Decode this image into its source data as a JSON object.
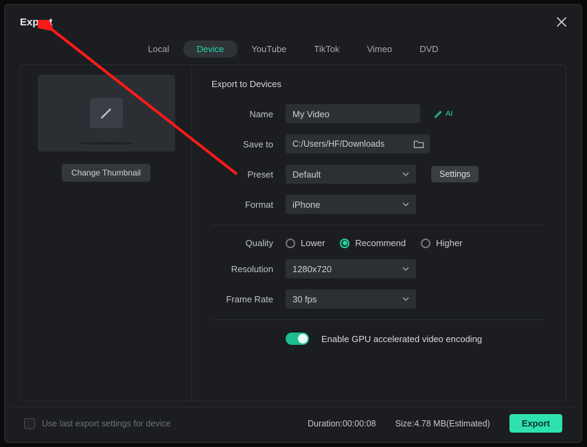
{
  "title": "Export",
  "tabs": [
    "Local",
    "Device",
    "YouTube",
    "TikTok",
    "Vimeo",
    "DVD"
  ],
  "active_tab": "Device",
  "left": {
    "change_thumbnail": "Change Thumbnail"
  },
  "form": {
    "section_title": "Export to Devices",
    "name_label": "Name",
    "name_value": "My Video",
    "ai_label": "AI",
    "save_to_label": "Save to",
    "save_to_value": "C:/Users/HF/Downloads",
    "preset_label": "Preset",
    "preset_value": "Default",
    "settings_btn": "Settings",
    "format_label": "Format",
    "format_value": "iPhone",
    "quality_label": "Quality",
    "quality_options": [
      "Lower",
      "Recommend",
      "Higher"
    ],
    "quality_selected": "Recommend",
    "resolution_label": "Resolution",
    "resolution_value": "1280x720",
    "frame_rate_label": "Frame Rate",
    "frame_rate_value": "30 fps",
    "gpu_label": "Enable GPU accelerated video encoding"
  },
  "footer": {
    "use_last": "Use last export settings for device",
    "duration_label": "Duration:",
    "duration_value": "00:00:08",
    "size_label": "Size:",
    "size_value": "4.78 MB(Estimated)",
    "export_btn": "Export"
  }
}
